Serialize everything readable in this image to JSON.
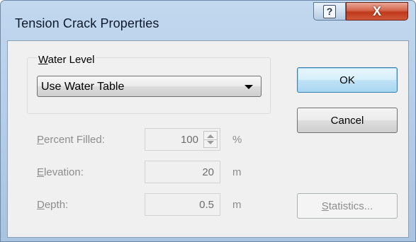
{
  "window": {
    "title": "Tension Crack Properties",
    "help_icon": "question-mark-icon",
    "close_label": "X",
    "close_color": "#c4391c"
  },
  "water_level": {
    "group_title_mnemonic": "W",
    "group_title_rest": "ater Level",
    "selected_value": "Use Water Table",
    "dropdown_icon": "chevron-down-icon"
  },
  "fields": {
    "percent_filled": {
      "label_mnemonic": "P",
      "label_rest": "ercent Filled:",
      "value": "100",
      "unit": "%"
    },
    "elevation": {
      "label_mnemonic": "E",
      "label_rest": "levation:",
      "value": "20",
      "unit": "m"
    },
    "depth": {
      "label_mnemonic": "D",
      "label_rest": "epth:",
      "value": "0.5",
      "unit": "m"
    }
  },
  "buttons": {
    "ok": "OK",
    "cancel": "Cancel",
    "statistics_mnemonic": "S",
    "statistics_rest": "tatistics..."
  }
}
